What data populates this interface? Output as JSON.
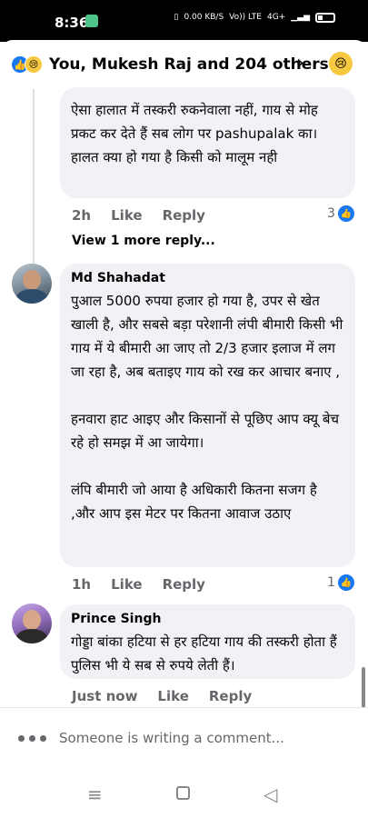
{
  "status_bar": {
    "time": "8:36",
    "net_speed": "0.00 KB/S",
    "volte": "Vo)) LTE",
    "network": "4G+"
  },
  "header": {
    "title": "You, Mukesh Raj and 204 others",
    "chevron": "›",
    "like_glyph": "👍",
    "sad_glyph": "😢"
  },
  "comments": [
    {
      "author": "",
      "text": "ऐसा हालात में तस्करी रुकनेवाला नहीं, गाय से मोह प्रकट कर देते हैं सब लोग पर pashupalak का।हालत क्या हो गया है किसी को मालूम नही",
      "time": "2h",
      "like": "Like",
      "reply": "Reply",
      "reactions": "3"
    },
    {
      "author": "Md Shahadat",
      "text": "पुआल 5000 रुपया हजार हो गया है, उपर से खेत खाली है, और सबसे बड़ा परेशानी लंपी बीमारी किसी भी गाय में ये बीमारी आ जाए तो 2/3 हजार इलाज में लग जा रहा है, अब बताइए गाय को रख कर आचार बनाए ,\n\nहनवारा हाट आइए और किसानों से पूछिए आप क्यू बेच रहे हो  समझ में आ जायेगा।\n\nलंपि बीमारी जो आया है अधिकारी कितना सजग है ,और आप इस मेटर पर कितना आवाज उठाए",
      "time": "1h",
      "like": "Like",
      "reply": "Reply",
      "reactions": "1"
    },
    {
      "author": "Prince Singh",
      "text": "गोड्डा बांका हटिया से हर हटिया गाय की तस्करी होता हैं पुलिस भी ये सब से रुपये लेती हैं।",
      "time": "Just now",
      "like": "Like",
      "reply": "Reply"
    }
  ],
  "view_more": "View 1 more reply...",
  "writing_indicator": "Someone is writing a comment...",
  "nav": {
    "menu": "≡",
    "back": "◁"
  },
  "colors": {
    "accent": "#1877f2",
    "bubble": "#f0f2f5",
    "muted": "#65676b",
    "reaction_sad": "#f7c940"
  }
}
